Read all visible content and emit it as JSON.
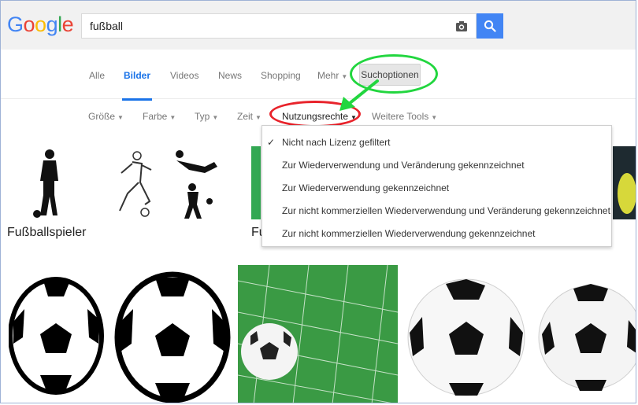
{
  "logo": {
    "letters": [
      "G",
      "o",
      "o",
      "g",
      "l",
      "e"
    ],
    "colors": [
      "#4285f4",
      "#ea4335",
      "#fbbc05",
      "#4285f4",
      "#34a853",
      "#ea4335"
    ]
  },
  "search": {
    "query": "fußball",
    "placeholder": ""
  },
  "icons": {
    "camera": "camera-icon",
    "search": "search-icon",
    "check": "check-icon"
  },
  "nav": {
    "tabs": [
      "Alle",
      "Bilder",
      "Videos",
      "News",
      "Shopping",
      "Mehr"
    ],
    "active_tab": "Bilder",
    "options_button": "Suchoptionen"
  },
  "tools": {
    "items": [
      "Größe",
      "Farbe",
      "Typ",
      "Zeit",
      "Nutzungsrechte",
      "Weitere Tools"
    ],
    "active": "Nutzungsrechte"
  },
  "dropdown": {
    "options": [
      "Nicht nach Lizenz gefiltert",
      "Zur Wiederverwendung und Veränderung gekennzeichnet",
      "Zur Wiederverwendung gekennzeichnet",
      "Zur nicht kommerziellen Wiederverwendung und Veränderung gekennzeichnet",
      "Zur nicht kommerziellen Wiederverwendung gekennzeichnet"
    ],
    "selected": "Nicht nach Lizenz gefiltert"
  },
  "related": {
    "first_label": "Fußballspieler",
    "second_label": "Fu"
  },
  "colors": {
    "accent": "#1a73e8",
    "search_button": "#4285f4",
    "highlight_green": "#22d63f",
    "highlight_red": "#e8232b"
  }
}
